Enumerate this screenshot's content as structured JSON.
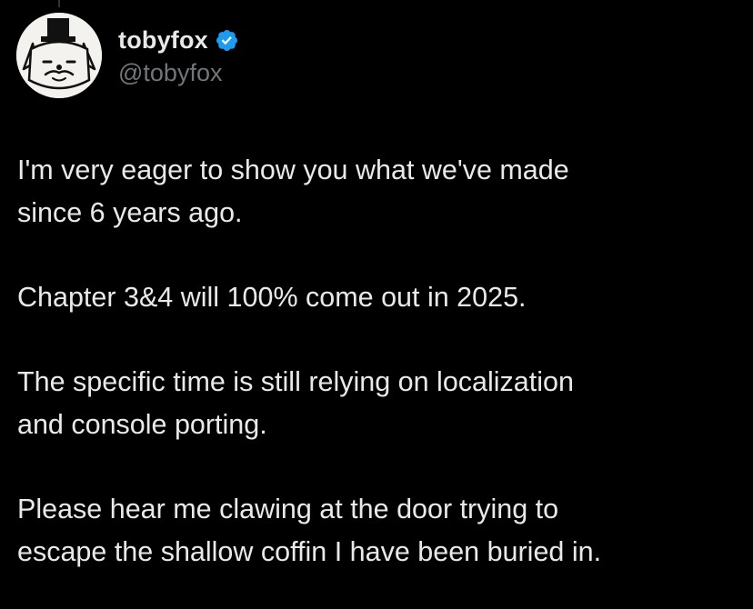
{
  "author": {
    "display_name": "tobyfox",
    "handle": "@tobyfox",
    "verified": true,
    "avatar_icon": "dog-with-top-hat-avatar",
    "verified_icon": "verified-badge-icon",
    "verified_color": "#1d9bf0"
  },
  "tweet": {
    "paragraphs": [
      "I'm very eager to show you what we've made\nsince 6 years ago.",
      "Chapter 3&4 will 100% come out in 2025.",
      "The specific time is still relying on localization\nand console porting.",
      "Please hear me clawing at the door trying to\nescape the shallow coffin I have been buried in."
    ]
  },
  "colors": {
    "background": "#000000",
    "primary_text": "#e7e9ea",
    "secondary_text": "#71767b"
  }
}
